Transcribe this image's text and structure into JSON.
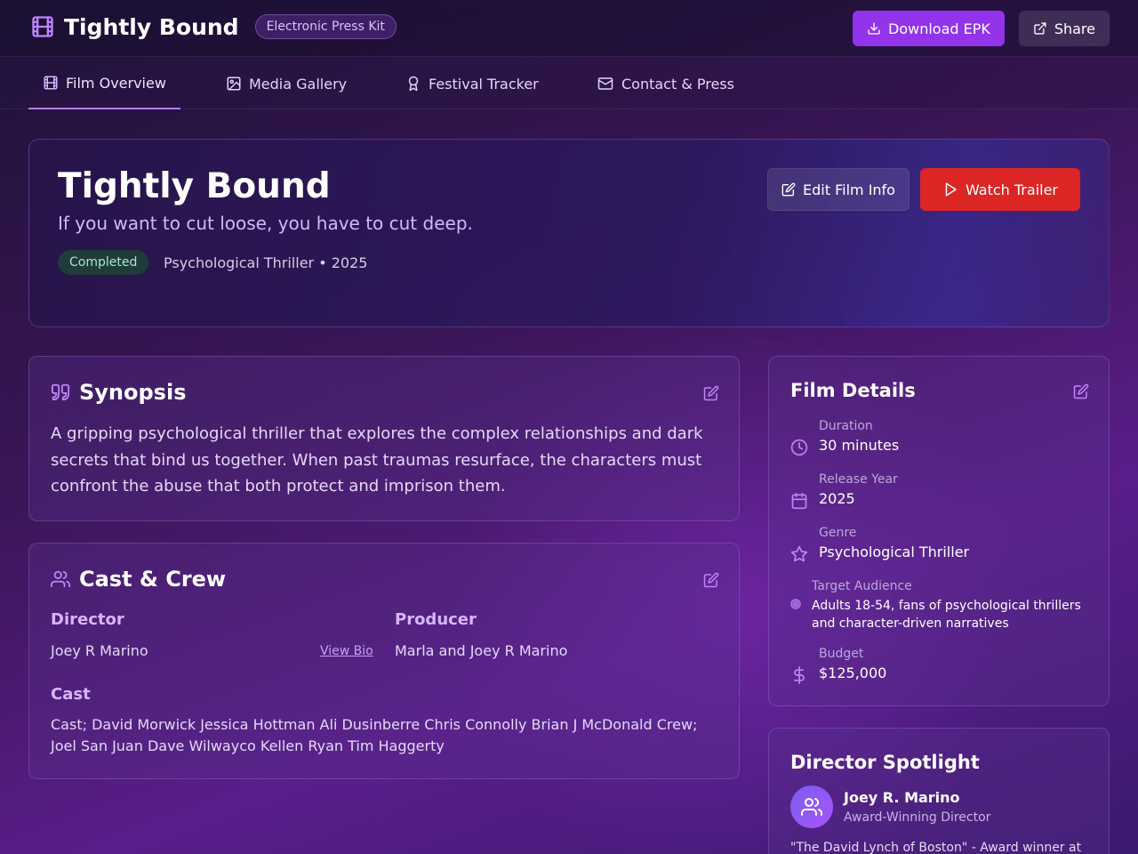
{
  "header": {
    "app_title": "Tightly Bound",
    "badge": "Electronic Press Kit",
    "download_label": "Download EPK",
    "share_label": "Share"
  },
  "tabs": [
    {
      "label": "Film Overview",
      "icon": "film-icon",
      "active": true
    },
    {
      "label": "Media Gallery",
      "icon": "image-icon",
      "active": false
    },
    {
      "label": "Festival Tracker",
      "icon": "award-icon",
      "active": false
    },
    {
      "label": "Contact & Press",
      "icon": "mail-icon",
      "active": false
    }
  ],
  "hero": {
    "title": "Tightly Bound",
    "tagline": "If you want to cut loose, you have to cut deep.",
    "status": "Completed",
    "meta": "Psychological Thriller • 2025",
    "edit_label": "Edit Film Info",
    "trailer_label": "Watch Trailer"
  },
  "synopsis": {
    "title": "Synopsis",
    "text": "A gripping psychological thriller that explores the complex relationships and dark secrets that bind us together. When past traumas resurface, the characters must confront the abuse that both protect and imprison them."
  },
  "cast_crew": {
    "title": "Cast & Crew",
    "director_heading": "Director",
    "director_name": "Joey R Marino",
    "view_bio": "View Bio",
    "producer_heading": "Producer",
    "producer_name": "Marla and Joey R Marino",
    "cast_heading": "Cast",
    "cast_text": "Cast; David Morwick Jessica Hottman Ali Dusinberre Chris Connolly Brian J McDonald Crew; Joel San Juan Dave Wilwayco Kellen Ryan Tim Haggerty"
  },
  "film_details": {
    "title": "Film Details",
    "items": [
      {
        "label": "Duration",
        "value": "30 minutes",
        "icon": "clock-icon"
      },
      {
        "label": "Release Year",
        "value": "2025",
        "icon": "calendar-icon"
      },
      {
        "label": "Genre",
        "value": "Psychological Thriller",
        "icon": "star-icon"
      },
      {
        "label": "Target Audience",
        "value": "Adults 18-54, fans of psychological thrillers and character-driven narratives",
        "icon": "target-icon"
      },
      {
        "label": "Budget",
        "value": "$125,000",
        "icon": "dollar-icon"
      }
    ]
  },
  "spotlight": {
    "title": "Director Spotlight",
    "name": "Joey R. Marino",
    "role": "Award-Winning Director",
    "quote": "\"The David Lynch of Boston\" - Award winner at"
  },
  "colors": {
    "accent": "#9333ea",
    "trailer": "#dc2626",
    "status_bg": "#1f3b3a",
    "status_text": "#a7e7c8"
  }
}
